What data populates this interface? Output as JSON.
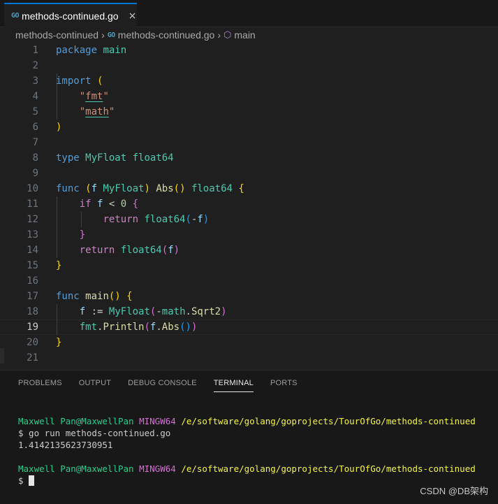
{
  "tab": {
    "icon": "go-file-icon",
    "label": "methods-continued.go",
    "close": "×"
  },
  "breadcrumb": {
    "folder": "methods-continued",
    "file": "methods-continued.go",
    "symbol": "main"
  },
  "editor": {
    "active_line": 19,
    "line_numbers": [
      "1",
      "2",
      "3",
      "4",
      "5",
      "6",
      "7",
      "8",
      "9",
      "10",
      "11",
      "12",
      "13",
      "14",
      "15",
      "16",
      "17",
      "18",
      "19",
      "20",
      "21"
    ]
  },
  "panel": {
    "tabs": [
      "PROBLEMS",
      "OUTPUT",
      "DEBUG CONSOLE",
      "TERMINAL",
      "PORTS"
    ],
    "active_tab": "TERMINAL"
  },
  "terminal": {
    "user": "Maxwell Pan@MaxwellPan",
    "env": "MINGW64",
    "path": "/e/software/golang/goprojects/TourOfGo/methods-continued",
    "command": "$ go run methods-continued.go",
    "output": "1.4142135623730951",
    "prompt": "$ "
  },
  "watermark": "CSDN @DB架构",
  "colors": {
    "accent": "#0078d4",
    "keyword": "#569cd6",
    "type": "#4ec9b0",
    "function": "#dcdcaa",
    "string": "#ce9178",
    "terminal_green": "#23d18b",
    "terminal_magenta": "#d670d6",
    "terminal_yellow": "#f5f543"
  }
}
